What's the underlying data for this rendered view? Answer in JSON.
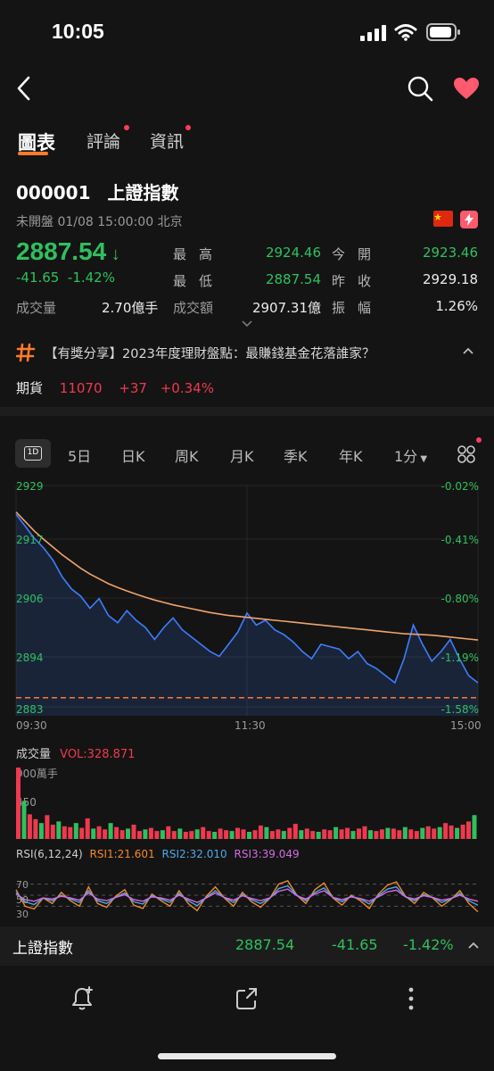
{
  "status_bar": {
    "time": "10:05",
    "signal_icon": "signal-icon",
    "wifi_icon": "wifi-icon",
    "battery_icon": "battery-icon"
  },
  "nav": {
    "back_icon": "back-icon",
    "search_icon": "search-icon",
    "favorite_icon": "heart-icon",
    "favorite_color": "#ff5a6e"
  },
  "tabs": [
    {
      "label": "圖表",
      "active": true
    },
    {
      "label": "評論",
      "badge": true
    },
    {
      "label": "資訊",
      "badge": true
    }
  ],
  "stock": {
    "code": "000001",
    "name": "上證指數",
    "status": "未開盤 01/08 15:00:00 北京",
    "price": "2887.54",
    "change": "-41.65",
    "change_pct": "-1.42%",
    "flag_icon": "china-flag-icon",
    "lightning_icon": "lightning-icon"
  },
  "quote": {
    "high_label": "最高",
    "high": "2924.46",
    "low_label": "最低",
    "low": "2887.54",
    "open_label": "今開",
    "open": "2923.46",
    "prev_close_label": "昨收",
    "prev_close": "2929.18",
    "volume_label": "成交量",
    "volume": "2.70億手",
    "turnover_label": "成交額",
    "turnover": "2907.31億",
    "amplitude_label": "振幅",
    "amplitude": "1.26%"
  },
  "news": {
    "icon": "hash-icon",
    "text": "【有獎分享】2023年度理財盤點：最賺錢基金花落誰家？"
  },
  "futures": {
    "label": "期貨",
    "value": "11070",
    "change": "+37",
    "change_pct": "+0.34%"
  },
  "periods": [
    "1D",
    "5日",
    "日K",
    "周K",
    "月K",
    "季K",
    "年K",
    "1分"
  ],
  "chart_data": {
    "type": "line",
    "title": "",
    "x_ticks": [
      "09:30",
      "11:30",
      "15:00"
    ],
    "y_ticks_left": [
      "2929",
      "2917",
      "2906",
      "2894",
      "2883"
    ],
    "y_ticks_right": [
      "-0.02%",
      "-0.41%",
      "-0.80%",
      "-1.19%",
      "-1.58%"
    ],
    "ylim": [
      2883,
      2929
    ],
    "series": [
      {
        "color": "#3d7eff",
        "values": [
          2923.0,
          2920.5,
          2918.0,
          2916.0,
          2913.5,
          2910.0,
          2907.5,
          2906.0,
          2903.5,
          2905.5,
          2902.0,
          2900.5,
          2903.0,
          2901.0,
          2899.5,
          2897.0,
          2899.5,
          2901.5,
          2899.0,
          2897.5,
          2896.0,
          2894.5,
          2893.5,
          2896.0,
          2898.5,
          2902.5,
          2900.0,
          2901.0,
          2899.0,
          2898.0,
          2896.5,
          2894.5,
          2893.0,
          2896.0,
          2895.5,
          2895.0,
          2893.0,
          2894.5,
          2892.0,
          2891.0,
          2889.5,
          2888.0,
          2893.0,
          2900.0,
          2896.0,
          2892.5,
          2894.5,
          2897.0,
          2893.0,
          2889.5,
          2888.0
        ]
      },
      {
        "color": "#f0a36b",
        "values": [
          2923.5,
          2921.5,
          2919.5,
          2917.8,
          2916.2,
          2914.6,
          2913.2,
          2911.8,
          2910.6,
          2909.6,
          2908.6,
          2907.8,
          2907.1,
          2906.4,
          2905.8,
          2905.2,
          2904.7,
          2904.2,
          2903.8,
          2903.4,
          2903.0,
          2902.6,
          2902.3,
          2902.0,
          2901.8,
          2901.6,
          2901.4,
          2901.2,
          2901.0,
          2900.8,
          2900.6,
          2900.4,
          2900.2,
          2900.0,
          2899.8,
          2899.6,
          2899.4,
          2899.2,
          2899.0,
          2898.8,
          2898.6,
          2898.4,
          2898.2,
          2898.1,
          2898.0,
          2897.9,
          2897.7,
          2897.5,
          2897.3,
          2897.1,
          2896.9
        ]
      }
    ],
    "reference_line": 2884.9
  },
  "volume": {
    "label": "成交量",
    "vol_text": "VOL:328.871",
    "y_ticks": [
      "900萬手",
      "450"
    ],
    "values": [
      9.0,
      4.8,
      3.1,
      2.5,
      2.0,
      3.0,
      1.8,
      2.2,
      1.6,
      1.5,
      2.0,
      1.4,
      2.6,
      1.3,
      1.6,
      1.2,
      2.0,
      1.5,
      1.1,
      1.3,
      1.8,
      1.0,
      1.2,
      1.4,
      1.0,
      1.1,
      1.6,
      1.0,
      1.3,
      0.9,
      1.0,
      1.2,
      1.5,
      1.0,
      0.9,
      1.3,
      1.1,
      1.0,
      1.4,
      1.2,
      0.9,
      1.1,
      1.7,
      1.5,
      1.0,
      1.2,
      1.0,
      1.4,
      1.9,
      1.1,
      1.3,
      1.0,
      0.9,
      1.2,
      1.1,
      1.5,
      1.2,
      1.4,
      1.0,
      1.3,
      1.6,
      1.1,
      1.0,
      1.2,
      1.4,
      1.3,
      1.1,
      1.5,
      1.2,
      1.0,
      1.4,
      1.6,
      1.3,
      1.5,
      2.0,
      1.7,
      1.4,
      1.8,
      2.2,
      3.0
    ],
    "up_color": "#f0394f",
    "down_color": "#2fc05e"
  },
  "rsi": {
    "label": "RSI(6,12,24)",
    "rsi1": "RSI1:21.601",
    "rsi2": "RSI2:32.010",
    "rsi3": "RSI3:39.049",
    "rsi1_color": "#f08a2c",
    "rsi2_color": "#4fa8e8",
    "rsi3_color": "#d26ce0",
    "levels": [
      "70",
      "50",
      "30"
    ],
    "rsi1_values": [
      60,
      30,
      25,
      45,
      35,
      55,
      40,
      30,
      65,
      35,
      28,
      48,
      60,
      32,
      26,
      52,
      40,
      30,
      58,
      35,
      22,
      48,
      65,
      45,
      30,
      55,
      38,
      28,
      44,
      70,
      76,
      50,
      35,
      60,
      72,
      45,
      32,
      50,
      40,
      26,
      52,
      68,
      74,
      48,
      35,
      55,
      45,
      30,
      42,
      58,
      35,
      20
    ],
    "rsi2_values": [
      55,
      38,
      33,
      45,
      40,
      50,
      43,
      37,
      58,
      40,
      35,
      46,
      54,
      38,
      34,
      49,
      43,
      37,
      53,
      40,
      31,
      46,
      58,
      46,
      37,
      51,
      42,
      35,
      44,
      62,
      67,
      50,
      40,
      55,
      63,
      46,
      38,
      48,
      43,
      34,
      49,
      61,
      65,
      47,
      40,
      51,
      46,
      37,
      43,
      53,
      40,
      32
    ],
    "rsi3_values": [
      52,
      42,
      39,
      45,
      43,
      48,
      45,
      41,
      54,
      43,
      40,
      46,
      51,
      42,
      39,
      47,
      45,
      41,
      50,
      43,
      37,
      45,
      54,
      46,
      41,
      49,
      44,
      40,
      45,
      57,
      61,
      49,
      43,
      52,
      58,
      46,
      42,
      47,
      44,
      39,
      47,
      56,
      59,
      47,
      43,
      49,
      46,
      41,
      44,
      50,
      43,
      39
    ]
  },
  "bottom": {
    "name": "上證指數",
    "price": "2887.54",
    "change": "-41.65",
    "change_pct": "-1.42%"
  },
  "toolbar": {
    "alert_icon": "bell-plus-icon",
    "share_icon": "share-icon",
    "more_icon": "more-vertical-icon"
  }
}
